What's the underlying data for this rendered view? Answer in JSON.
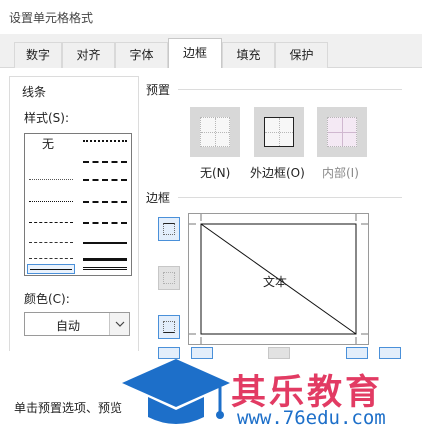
{
  "window": {
    "title": "设置单元格格式"
  },
  "tabs": [
    {
      "label": "数字"
    },
    {
      "label": "对齐"
    },
    {
      "label": "字体"
    },
    {
      "label": "边框",
      "active": true
    },
    {
      "label": "填充"
    },
    {
      "label": "保护"
    }
  ],
  "line": {
    "group_label": "线条",
    "style_label": "样式(S):",
    "none_label": "无",
    "color_label": "颜色(C):",
    "color_value": "自动"
  },
  "presets": {
    "group_label": "预置",
    "items": [
      {
        "label": "无(N)"
      },
      {
        "label": "外边框(O)"
      },
      {
        "label": "内部(I)"
      }
    ]
  },
  "border": {
    "group_label": "边框",
    "preview_text": "文本"
  },
  "footer": {
    "text": "单击预置选项、预览"
  },
  "watermark": {
    "name": "其乐教育",
    "url": "www.76edu.com"
  },
  "colors": {
    "accent": "#4a90d9",
    "watermark_pink": "#e23b63",
    "watermark_blue": "#1d6fc9"
  }
}
